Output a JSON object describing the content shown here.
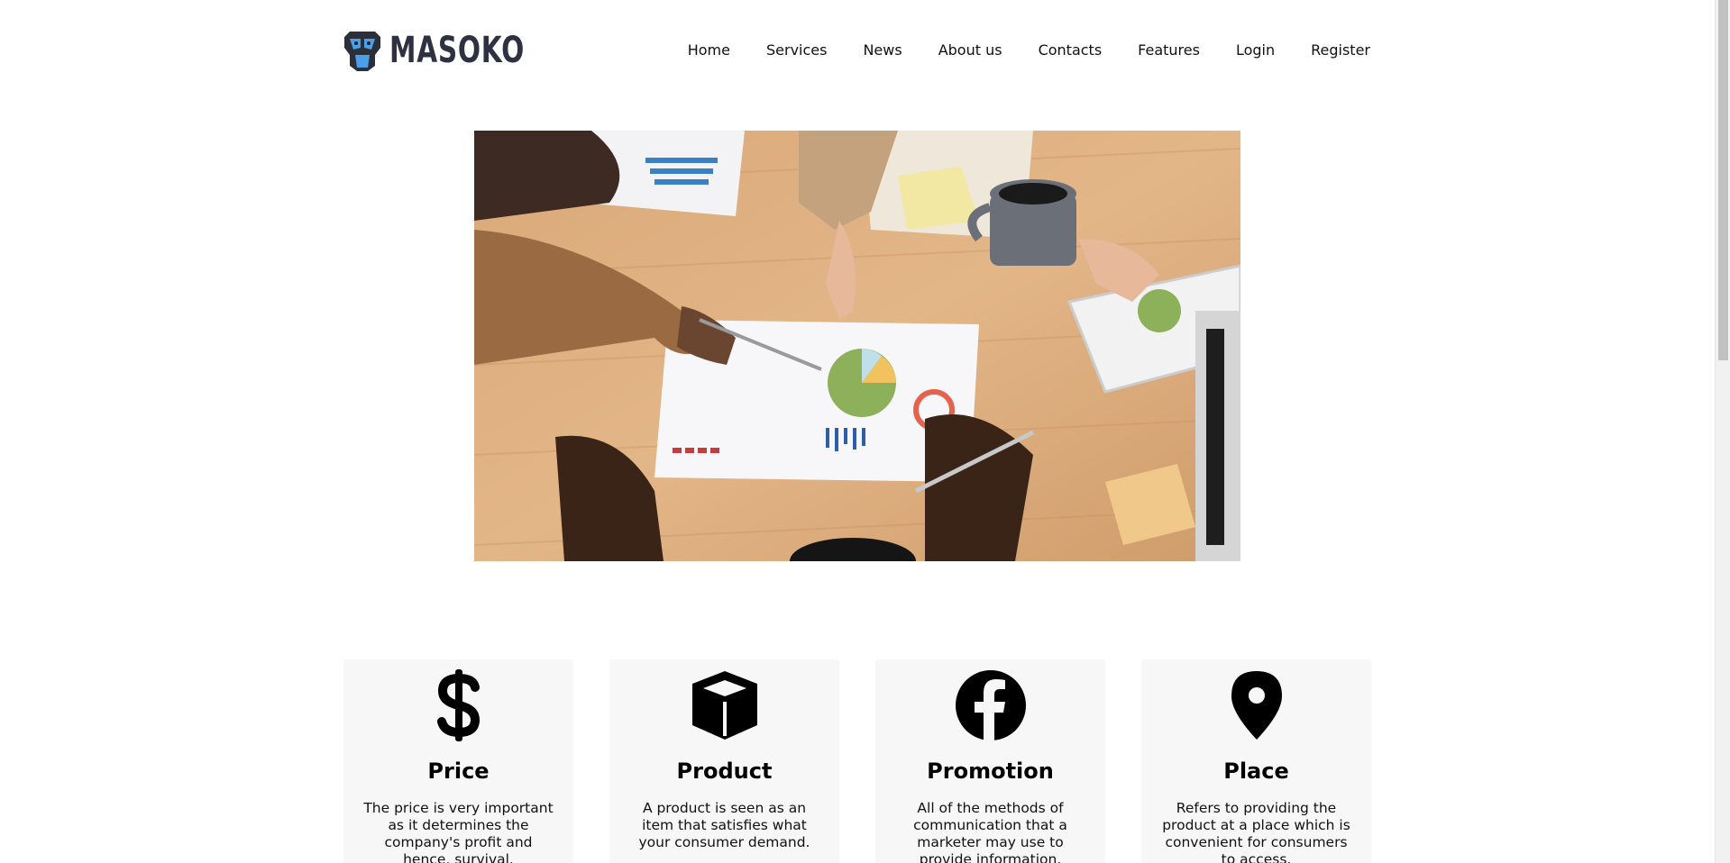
{
  "brand": {
    "name": "MASOKO",
    "colors": {
      "logo_text": "#2e3142",
      "logo_blue": "#4a9fe6",
      "logo_dark": "#2b2f3a"
    }
  },
  "nav": {
    "items": [
      {
        "label": "Home"
      },
      {
        "label": "Services"
      },
      {
        "label": "News"
      },
      {
        "label": "About us"
      },
      {
        "label": "Contacts"
      },
      {
        "label": "Features"
      },
      {
        "label": "Login"
      },
      {
        "label": "Register"
      }
    ]
  },
  "cards": [
    {
      "icon": "dollar-icon",
      "title": "Price",
      "text": "The price is very important as it determines the company's profit and hence, survival."
    },
    {
      "icon": "cube-icon",
      "title": "Product",
      "text": "A product is seen as an item that satisfies what your consumer demand."
    },
    {
      "icon": "facebook-icon",
      "title": "Promotion",
      "text": "All of the methods of communication that a marketer may use to provide information."
    },
    {
      "icon": "map-pin-icon",
      "title": "Place",
      "text": "Refers to providing the product at a place which is convenient for consumers to access."
    }
  ],
  "colors": {
    "card_bg": "#f7f7f7",
    "page_bg": "#ffffff"
  }
}
